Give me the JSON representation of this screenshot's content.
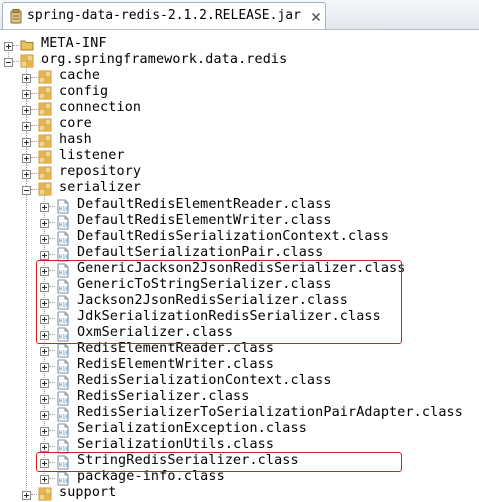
{
  "tab": {
    "title": "spring-data-redis-2.1.2.RELEASE.jar",
    "icon": "jar-icon",
    "close_icon": "close-icon"
  },
  "tree": [
    {
      "label": "META-INF",
      "type": "folder",
      "depth": 0,
      "expanded": false
    },
    {
      "label": "org.springframework.data.redis",
      "type": "package",
      "depth": 0,
      "expanded": true
    },
    {
      "label": "cache",
      "type": "package",
      "depth": 1,
      "expanded": false
    },
    {
      "label": "config",
      "type": "package",
      "depth": 1,
      "expanded": false
    },
    {
      "label": "connection",
      "type": "package",
      "depth": 1,
      "expanded": false
    },
    {
      "label": "core",
      "type": "package",
      "depth": 1,
      "expanded": false
    },
    {
      "label": "hash",
      "type": "package",
      "depth": 1,
      "expanded": false
    },
    {
      "label": "listener",
      "type": "package",
      "depth": 1,
      "expanded": false
    },
    {
      "label": "repository",
      "type": "package",
      "depth": 1,
      "expanded": false
    },
    {
      "label": "serializer",
      "type": "package",
      "depth": 1,
      "expanded": true
    },
    {
      "label": "DefaultRedisElementReader.class",
      "type": "class",
      "depth": 2,
      "expanded": false
    },
    {
      "label": "DefaultRedisElementWriter.class",
      "type": "class",
      "depth": 2,
      "expanded": false
    },
    {
      "label": "DefaultRedisSerializationContext.class",
      "type": "class",
      "depth": 2,
      "expanded": false
    },
    {
      "label": "DefaultSerializationPair.class",
      "type": "class",
      "depth": 2,
      "expanded": false
    },
    {
      "label": "GenericJackson2JsonRedisSerializer.class",
      "type": "class",
      "depth": 2,
      "expanded": false
    },
    {
      "label": "GenericToStringSerializer.class",
      "type": "class",
      "depth": 2,
      "expanded": false
    },
    {
      "label": "Jackson2JsonRedisSerializer.class",
      "type": "class",
      "depth": 2,
      "expanded": false
    },
    {
      "label": "JdkSerializationRedisSerializer.class",
      "type": "class",
      "depth": 2,
      "expanded": false
    },
    {
      "label": "OxmSerializer.class",
      "type": "class",
      "depth": 2,
      "expanded": false
    },
    {
      "label": "RedisElementReader.class",
      "type": "class",
      "depth": 2,
      "expanded": false
    },
    {
      "label": "RedisElementWriter.class",
      "type": "class",
      "depth": 2,
      "expanded": false
    },
    {
      "label": "RedisSerializationContext.class",
      "type": "class",
      "depth": 2,
      "expanded": false
    },
    {
      "label": "RedisSerializer.class",
      "type": "class",
      "depth": 2,
      "expanded": false
    },
    {
      "label": "RedisSerializerToSerializationPairAdapter.class",
      "type": "class",
      "depth": 2,
      "expanded": false
    },
    {
      "label": "SerializationException.class",
      "type": "class",
      "depth": 2,
      "expanded": false
    },
    {
      "label": "SerializationUtils.class",
      "type": "class",
      "depth": 2,
      "expanded": false
    },
    {
      "label": "StringRedisSerializer.class",
      "type": "class",
      "depth": 2,
      "expanded": false
    },
    {
      "label": "package-info.class",
      "type": "class",
      "depth": 2,
      "expanded": false
    },
    {
      "label": "support",
      "type": "package",
      "depth": 1,
      "expanded": false
    }
  ],
  "highlight_groups": [
    {
      "from": 14,
      "to": 18
    },
    {
      "from": 26,
      "to": 26
    }
  ],
  "colors": {
    "highlight_border": "#d12020",
    "package_icon": "#c89632",
    "class_icon": "#3b6fb0",
    "folder_icon": "#e8c35a",
    "tree_line": "#a0a0a0"
  }
}
